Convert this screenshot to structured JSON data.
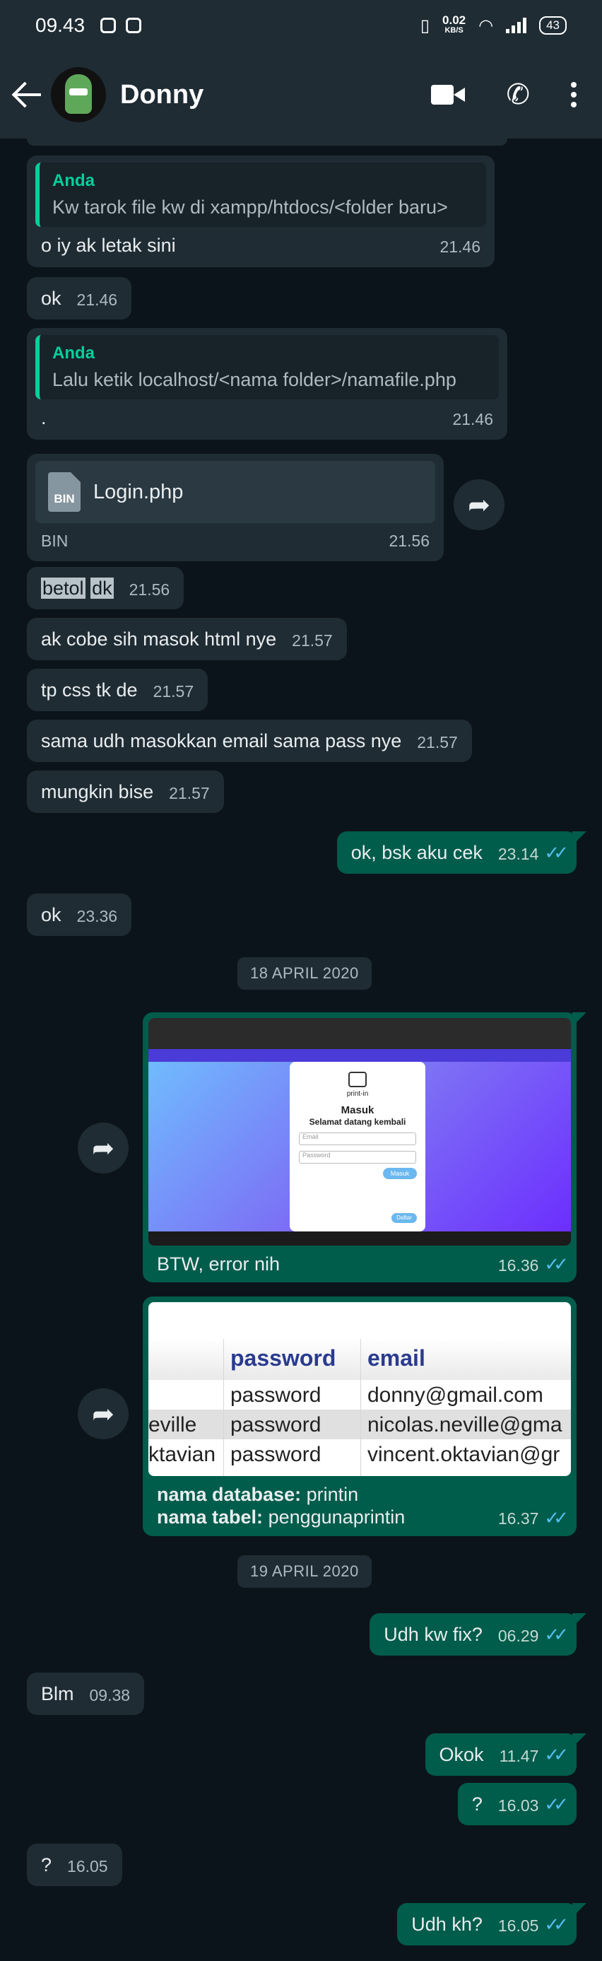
{
  "status_bar": {
    "time": "09.43",
    "speed_value": "0.02",
    "speed_unit": "KB/S",
    "battery": "43"
  },
  "header": {
    "contact_name": "Donny",
    "icons": [
      "back-arrow-icon",
      "video-call-icon",
      "phone-call-icon",
      "more-options-icon"
    ]
  },
  "messages": {
    "m1": {
      "quote_author": "Anda",
      "quote_text": "Kw tarok file kw di xampp/htdocs/<folder baru>",
      "text": "o iy ak letak sini",
      "time": "21.46"
    },
    "m2": {
      "text": "ok",
      "time": "21.46"
    },
    "m3": {
      "quote_author": "Anda",
      "quote_text": "Lalu ketik localhost/<nama folder>/namafile.php",
      "text": ".",
      "time": "21.46"
    },
    "m4": {
      "file_name": "Login.php",
      "file_type": "BIN",
      "file_icon_label": "BIN",
      "time": "21.56"
    },
    "m5": {
      "word1": "betol",
      "word2": "dk",
      "time": "21.56"
    },
    "m6": {
      "text": "ak cobe sih masok html nye",
      "time": "21.57"
    },
    "m7": {
      "text": "tp css tk de",
      "time": "21.57"
    },
    "m8": {
      "text": "sama udh masokkan email sama pass nye",
      "time": "21.57"
    },
    "m9": {
      "text": "mungkin bise",
      "time": "21.57"
    },
    "m10": {
      "text": "ok, bsk aku cek",
      "time": "23.14"
    },
    "m11": {
      "text": "ok",
      "time": "23.36"
    },
    "date1": "18 APRIL 2020",
    "m12": {
      "caption": "BTW, error nih",
      "time": "16.36",
      "screenshot": {
        "brand": "print-in",
        "title": "Masuk",
        "subtitle": "Selamat datang kembali",
        "email_placeholder": "Email",
        "password_placeholder": "Password",
        "login_button": "Masuk",
        "signup_button": "Daftar"
      }
    },
    "m13": {
      "table": {
        "headers": [
          "password",
          "email"
        ],
        "rows": [
          [
            "",
            "password",
            "donny@gmail.com"
          ],
          [
            "eville",
            "password",
            "nicolas.neville@gma"
          ],
          [
            "ktavian",
            "password",
            "vincent.oktavian@gr"
          ]
        ]
      },
      "db_label": "nama database:",
      "db_value": "printin",
      "table_label": "nama tabel:",
      "table_value": "penggunaprintin",
      "time": "16.37"
    },
    "date2": "19 APRIL 2020",
    "m14": {
      "text": "Udh kw fix?",
      "time": "06.29"
    },
    "m15": {
      "text": "Blm",
      "time": "09.38"
    },
    "m16": {
      "text": "Okok",
      "time": "11.47"
    },
    "m17": {
      "text": "?",
      "time": "16.03"
    },
    "m18": {
      "text": "?",
      "time": "16.05"
    },
    "m19": {
      "text": "Udh kh?",
      "time": "16.05"
    }
  },
  "colors": {
    "header_bg": "#1f2c34",
    "incoming_bubble": "#1f2c34",
    "outgoing_bubble": "#005c4b",
    "read_ticks": "#53bdeb",
    "quote_accent": "#06cf9c"
  }
}
